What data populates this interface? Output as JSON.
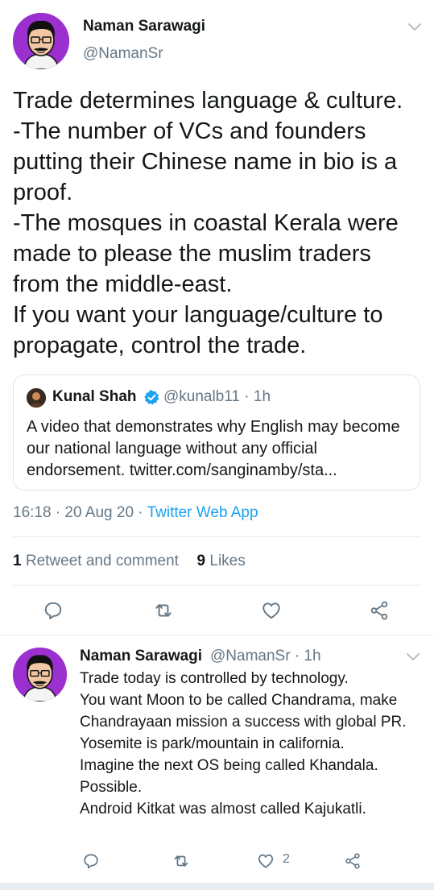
{
  "main_tweet": {
    "author_name": "Naman Sarawagi",
    "author_handle": "@NamanSr",
    "text": "Trade determines language & culture.\n-The number of VCs and founders putting their Chinese name in bio is a proof.\n-The mosques in coastal Kerala were made to please the muslim traders from the middle-east.\nIf you want your language/culture to propagate, control the trade.",
    "time": "16:18 · 20 Aug 20 · ",
    "source": "Twitter Web App",
    "retweet_count": "1",
    "retweet_label": " Retweet and comment",
    "like_count": "9",
    "like_label": " Likes"
  },
  "quoted_tweet": {
    "author_name": "Kunal Shah",
    "author_handle": "@kunalb11 · 1h",
    "text": "A video that demonstrates why English may become our national language without any official endorsement. twitter.com/sanginamby/sta..."
  },
  "reply_tweet": {
    "author_name": "Naman Sarawagi",
    "author_handle": "@NamanSr · 1h",
    "text": "Trade today is controlled by technology.\nYou want Moon to be called Chandrama, make Chandrayaan mission a success with global PR.\nYosemite is park/mountain in california.\nImagine the next OS being called Khandala. Possible.\nAndroid Kitkat was almost called Kajukatli.",
    "like_count": "2"
  },
  "icons": {
    "reply": "reply-icon",
    "retweet": "retweet-icon",
    "like": "heart-icon",
    "share": "share-icon",
    "menu": "chevron-down-icon",
    "verified": "verified-badge-icon"
  },
  "colors": {
    "accent": "#1da1f2",
    "secondary_text": "#657786",
    "primary_text": "#14171a",
    "avatar_background": "#9b2fd0"
  }
}
